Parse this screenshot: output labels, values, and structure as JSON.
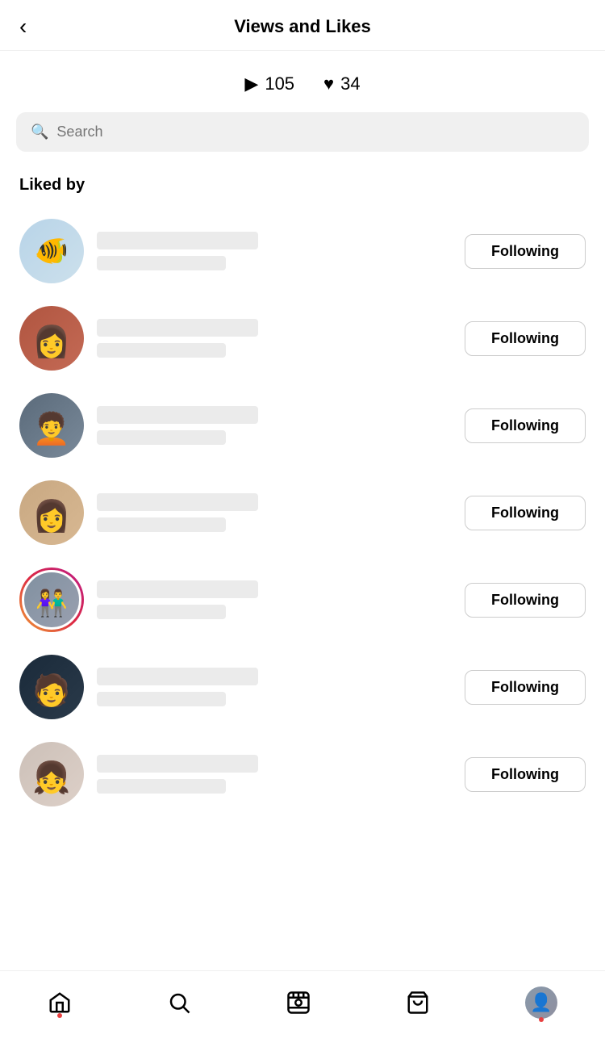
{
  "header": {
    "title": "Views and Likes",
    "back_label": "‹"
  },
  "stats": {
    "views_icon": "▶",
    "views_count": "105",
    "likes_icon": "♥",
    "likes_count": "34"
  },
  "search": {
    "placeholder": "Search"
  },
  "section": {
    "liked_by_label": "Liked by"
  },
  "users": [
    {
      "id": 1,
      "following_label": "Following",
      "avatar_class": "av1-fish",
      "has_story": false
    },
    {
      "id": 2,
      "following_label": "Following",
      "avatar_class": "av2-girl",
      "has_story": false
    },
    {
      "id": 3,
      "following_label": "Following",
      "avatar_class": "av3-person",
      "has_story": false
    },
    {
      "id": 4,
      "following_label": "Following",
      "avatar_class": "av4-woman",
      "has_story": false
    },
    {
      "id": 5,
      "following_label": "Following",
      "avatar_class": "av5-couple",
      "has_story": true
    },
    {
      "id": 6,
      "following_label": "Following",
      "avatar_class": "av6-dark",
      "has_story": false
    },
    {
      "id": 7,
      "following_label": "Following",
      "avatar_class": "av7-young",
      "has_story": false
    }
  ],
  "bottom_nav": {
    "home_icon": "⌂",
    "search_icon": "🔍",
    "reels_icon": "▶",
    "shop_icon": "🛍",
    "profile_icon": ""
  }
}
